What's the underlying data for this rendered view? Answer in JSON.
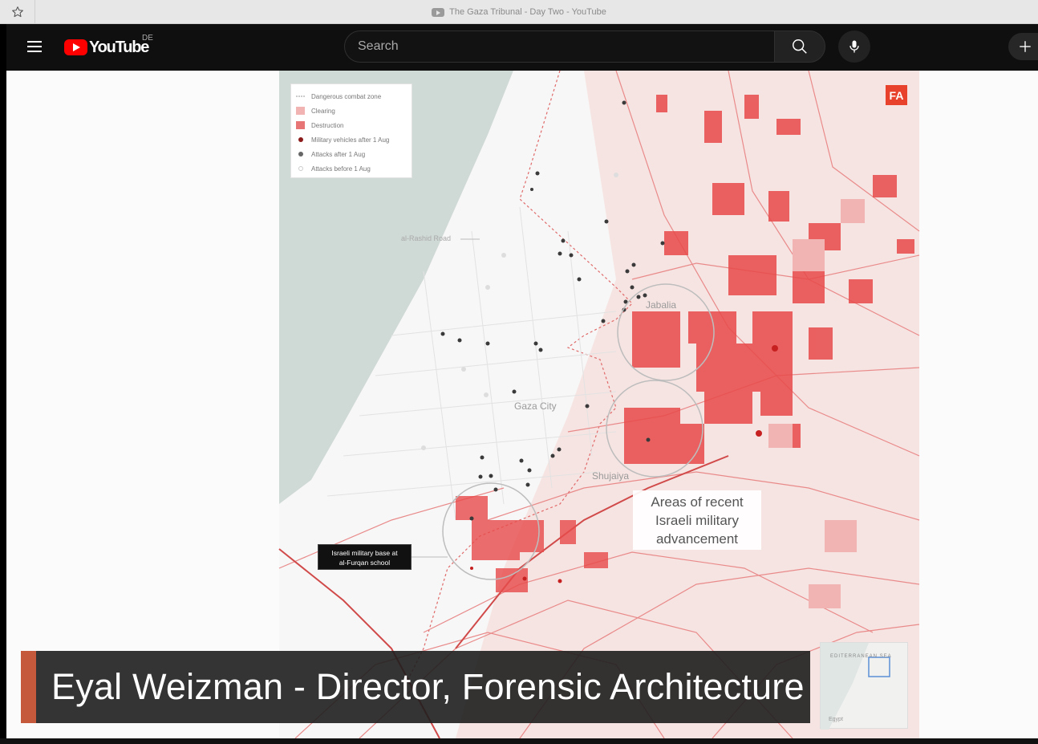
{
  "window": {
    "title": "The Gaza Tribunal - Day Two - YouTube"
  },
  "masthead": {
    "logo_text": "YouTube",
    "region_code": "DE",
    "search_placeholder": "Search"
  },
  "icons": {
    "bookmark": "star-icon",
    "menu": "hamburger-menu-icon",
    "search": "search-icon",
    "voice": "microphone-icon",
    "create": "plus-icon"
  },
  "video": {
    "legend": {
      "items": [
        {
          "label": "Dangerous combat zone",
          "symbol": "dashed-line"
        },
        {
          "label": "Clearing",
          "symbol": "light-red-square"
        },
        {
          "label": "Destruction",
          "symbol": "red-square"
        },
        {
          "label": "Military vehicles after 1 Aug",
          "symbol": "dark-red-dot"
        },
        {
          "label": "Attacks after 1 Aug",
          "symbol": "grey-dot"
        },
        {
          "label": "Attacks before 1 Aug",
          "symbol": "white-dot"
        }
      ]
    },
    "badge": "FA",
    "map_labels": {
      "road": "al-Rashid Road",
      "jabalia": "Jabalia",
      "gaza_city": "Gaza City",
      "shujaiya": "Shujaiya"
    },
    "callout": {
      "lines": [
        "Areas of recent",
        "Israeli military",
        "advancement"
      ]
    },
    "base_label": {
      "lines": [
        "Israeli military base at",
        "al-Furqan school"
      ]
    },
    "inset": {
      "sea_label": "EDITERRANEAN SEA",
      "country_label": "Egypt"
    },
    "lower_third": "Eyal Weizman - Director, Forensic Architecture"
  },
  "colors": {
    "destruction": "#e84a4a",
    "clearing": "#f2b3b3",
    "sea": "#cfd9d6",
    "masthead_bg": "#0f0f0f",
    "youtube_red": "#ff0000",
    "accent_bar": "#c45a3b"
  }
}
